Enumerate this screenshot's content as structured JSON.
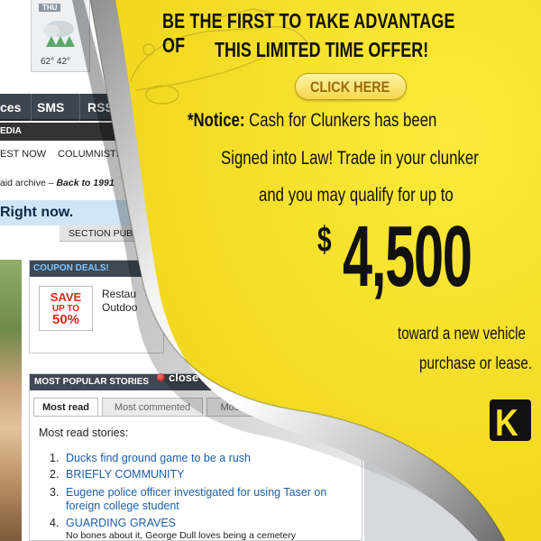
{
  "weather": {
    "day_label": "THU",
    "temps": "62° 42°"
  },
  "nav": {
    "services": "ces",
    "sms": "SMS",
    "rss": "RSS"
  },
  "subnav": {
    "label": "EDIA"
  },
  "tabs2": {
    "latest": "EST NOW",
    "columnists": "COLUMNISTS"
  },
  "archive": {
    "prefix": "aid archive – ",
    "back": "Back to 1991"
  },
  "banner": {
    "text": "Right now."
  },
  "section": {
    "label": "SECTION PUBL"
  },
  "coupon": {
    "header": "COUPON DEALS!",
    "badge": [
      "SAVE",
      "UP TO",
      "50%"
    ],
    "text1": "Restau",
    "text2": "Outdoo"
  },
  "popular": {
    "header": "MOST POPULAR STORIES",
    "tabs": [
      "Most read",
      "Most commented",
      "Most e-mailed"
    ],
    "list_title": "Most read stories:",
    "stories": [
      {
        "num": "1.",
        "title": "Ducks find ground game to be a rush",
        "sub": ""
      },
      {
        "num": "2.",
        "title": "BRIEFLY COMMUNITY",
        "sub": ""
      },
      {
        "num": "3.",
        "title": "Eugene police officer investigated for using Taser on foreign college student",
        "sub": ""
      },
      {
        "num": "4.",
        "title": "GUARDING GRAVES",
        "sub": "No bones about it, George Dull loves being a cemetery"
      }
    ]
  },
  "ad": {
    "headline1": "BE THE FIRST TO TAKE ADVANTAGE OF",
    "headline2": "THIS LIMITED TIME OFFER!",
    "button": "CLICK HERE",
    "notice_bold": "*Notice:",
    "notice_rest": " Cash for Clunkers has been",
    "line2": "Signed into Law! Trade in your clunker",
    "line3": "and you may qualify for up to",
    "amount_symbol": "$",
    "amount": "4,500",
    "toward": "toward a new vehicle",
    "purchase": "purchase or lease.",
    "logo": "K",
    "close": "close"
  },
  "colors": {
    "ad_yellow": "#f7e227",
    "link_blue": "#1b5ea8",
    "nav_dark": "#3c4550"
  }
}
